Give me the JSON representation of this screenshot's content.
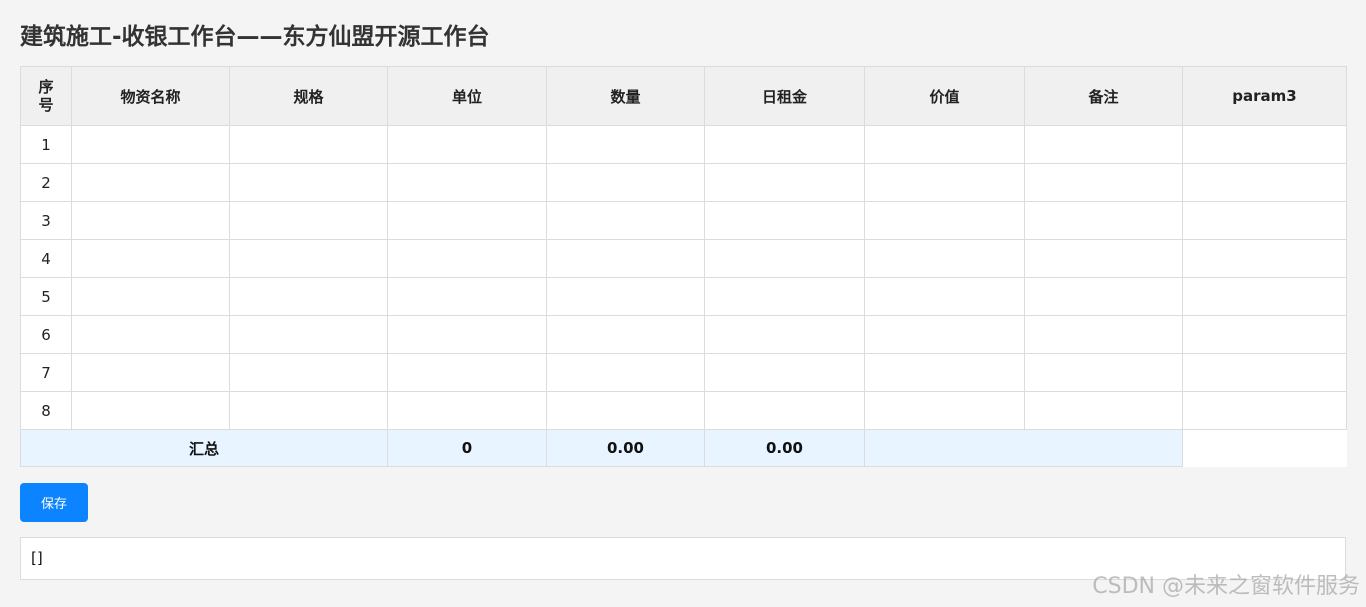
{
  "title": "建筑施工-收银工作台——东方仙盟开源工作台",
  "table": {
    "headers": {
      "seq": "序号",
      "seq_line1": "序",
      "seq_line2": "号",
      "name": "物资名称",
      "spec": "规格",
      "unit": "单位",
      "qty": "数量",
      "daily_rent": "日租金",
      "value": "价值",
      "remark": "备注",
      "param3": "param3"
    },
    "rows": [
      {
        "seq": "1"
      },
      {
        "seq": "2"
      },
      {
        "seq": "3"
      },
      {
        "seq": "4"
      },
      {
        "seq": "5"
      },
      {
        "seq": "6"
      },
      {
        "seq": "7"
      },
      {
        "seq": "8"
      }
    ],
    "summary": {
      "label": "汇总",
      "qty": "0",
      "daily_rent": "0.00",
      "value": "0.00"
    }
  },
  "save_button": {
    "label": "保存",
    "color": "#0d84ff"
  },
  "output": {
    "text": "[]"
  },
  "watermark": "CSDN @未来之窗软件服务"
}
